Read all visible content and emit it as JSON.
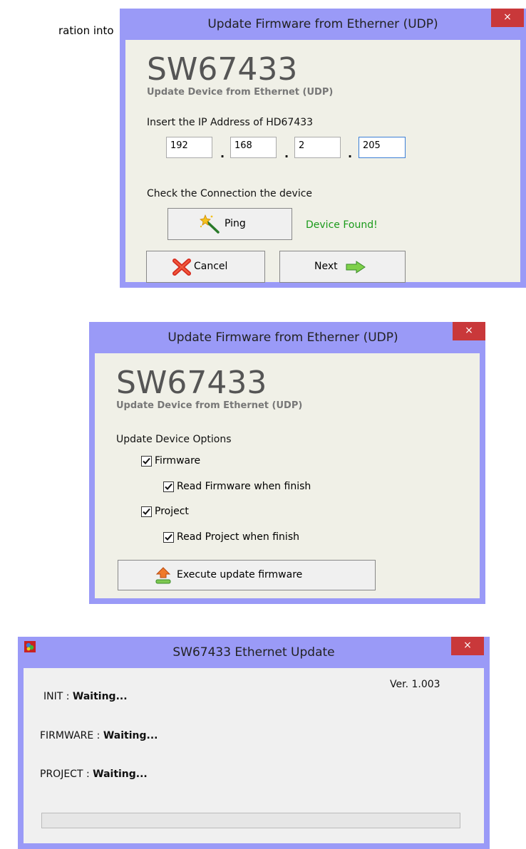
{
  "document": {
    "fragment": "ration into"
  },
  "window1": {
    "title": "Update Firmware from Etherner (UDP)",
    "close": "×",
    "app_name": "SW67433",
    "subtitle": "Update Device from Ethernet (UDP)",
    "ip_label": "Insert the IP Address of HD67433",
    "ip": [
      "192",
      "168",
      "2",
      "205"
    ],
    "ip_separator": ".",
    "check_label": "Check the Connection the device",
    "ping_label": "Ping",
    "status": "Device Found!",
    "cancel_label": "Cancel",
    "next_label": "Next"
  },
  "window2": {
    "title": "Update Firmware from Etherner (UDP)",
    "close": "×",
    "app_name": "SW67433",
    "subtitle": "Update Device from Ethernet (UDP)",
    "options_label": "Update Device Options",
    "options": [
      {
        "label": "Firmware",
        "checked": true
      },
      {
        "label": "Read Firmware when finish",
        "checked": true
      },
      {
        "label": "Project",
        "checked": true
      },
      {
        "label": "Read Project when finish",
        "checked": true
      }
    ],
    "execute_label": "Execute update firmware"
  },
  "window3": {
    "title": "SW67433 Ethernet Update",
    "close": "×",
    "version": "Ver. 1.003",
    "init_label": "INIT :",
    "init_value": "Waiting...",
    "firmware_label": "FIRMWARE :",
    "firmware_value": "Waiting...",
    "project_label": "PROJECT :",
    "project_value": "Waiting...",
    "progress": 0
  },
  "colors": {
    "frame": "#9a9af7",
    "close": "#c9383a",
    "client": "#f0f0e7",
    "found": "#1a9a1a"
  },
  "icons": [
    "magic-wand-icon",
    "red-x-icon",
    "green-arrow-icon",
    "upload-icon",
    "app-icon"
  ]
}
